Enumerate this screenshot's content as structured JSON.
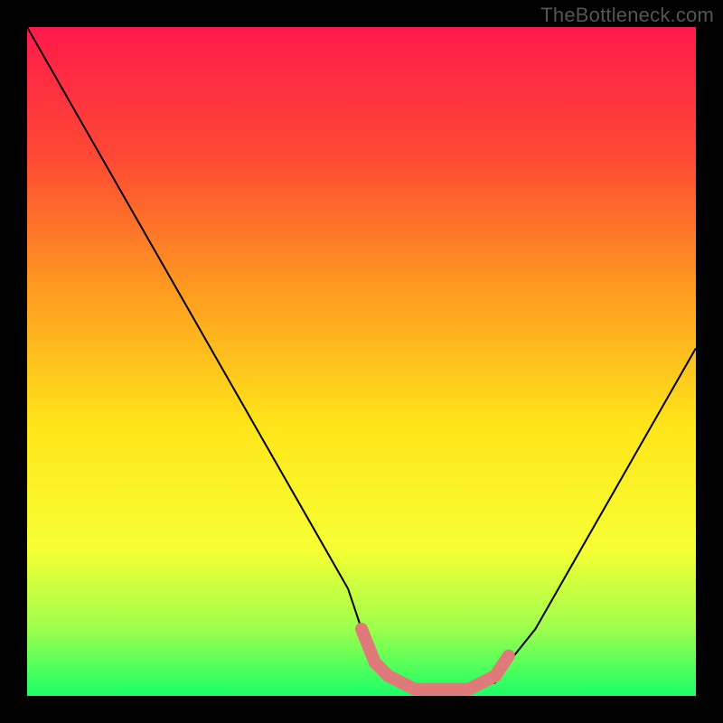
{
  "watermark": "TheBottleneck.com",
  "chart_data": {
    "type": "line",
    "title": "",
    "xlabel": "",
    "ylabel": "",
    "xlim": [
      0,
      100
    ],
    "ylim": [
      0,
      100
    ],
    "grid": false,
    "legend": false,
    "annotations": [],
    "gradient_stops": [
      {
        "offset": 0.0,
        "color": "#ff1a4b"
      },
      {
        "offset": 0.2,
        "color": "#ff4b33"
      },
      {
        "offset": 0.4,
        "color": "#ff9e1f"
      },
      {
        "offset": 0.6,
        "color": "#ffe61a"
      },
      {
        "offset": 0.78,
        "color": "#f6ff33"
      },
      {
        "offset": 0.9,
        "color": "#9cff4d"
      },
      {
        "offset": 1.0,
        "color": "#1aff66"
      }
    ],
    "series": [
      {
        "name": "bottleneck-curve",
        "color": "#000000",
        "x": [
          0,
          4,
          8,
          12,
          16,
          20,
          24,
          28,
          32,
          36,
          40,
          44,
          48,
          50,
          52,
          56,
          58,
          62,
          66,
          70,
          72,
          76,
          80,
          84,
          88,
          92,
          96,
          100
        ],
        "y": [
          100,
          93,
          86,
          79,
          72,
          65,
          58,
          51,
          44,
          37,
          30,
          23,
          16,
          10,
          5,
          2,
          1,
          1,
          1,
          2,
          5,
          10,
          17,
          24,
          31,
          38,
          45,
          52
        ]
      },
      {
        "name": "optimal-band",
        "color": "#e07a7a",
        "thick": true,
        "x": [
          50,
          52,
          54,
          56,
          58,
          60,
          62,
          64,
          66,
          68,
          70,
          72
        ],
        "y": [
          10,
          5,
          3,
          2,
          1,
          1,
          1,
          1,
          1,
          2,
          3,
          6
        ]
      }
    ]
  }
}
